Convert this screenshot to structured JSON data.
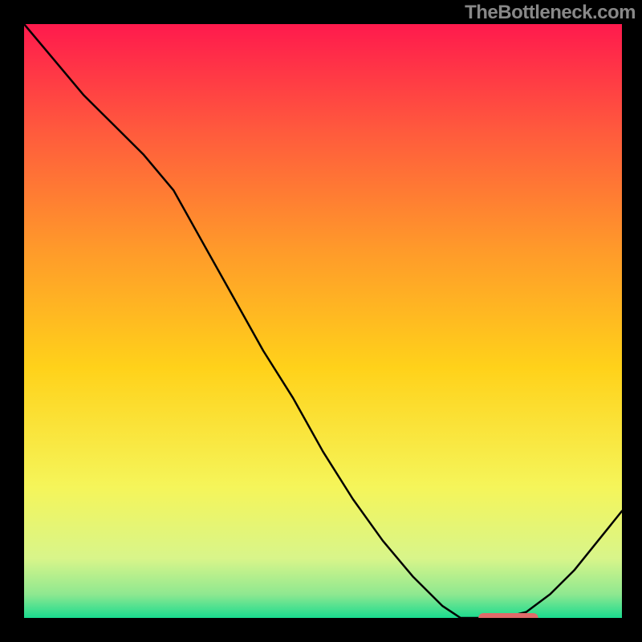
{
  "watermark": "TheBottleneck.com",
  "colors": {
    "gradient_stops": [
      {
        "offset": "0%",
        "color": "#ff1a4d"
      },
      {
        "offset": "18%",
        "color": "#ff5a3d"
      },
      {
        "offset": "38%",
        "color": "#ff9a2a"
      },
      {
        "offset": "58%",
        "color": "#ffd21a"
      },
      {
        "offset": "78%",
        "color": "#f5f55a"
      },
      {
        "offset": "90%",
        "color": "#d8f58a"
      },
      {
        "offset": "96%",
        "color": "#8fe890"
      },
      {
        "offset": "100%",
        "color": "#1adb8f"
      }
    ],
    "marker": "#e06a6a",
    "curve": "#000000",
    "frame": "#000000"
  },
  "chart_data": {
    "type": "line",
    "title": "",
    "xlabel": "",
    "ylabel": "",
    "xlim": [
      0,
      100
    ],
    "ylim": [
      0,
      100
    ],
    "grid": false,
    "legend": false,
    "x": [
      0,
      5,
      10,
      15,
      20,
      25,
      30,
      35,
      40,
      45,
      50,
      55,
      60,
      65,
      70,
      73,
      76,
      80,
      84,
      88,
      92,
      96,
      100
    ],
    "y": [
      100,
      94,
      88,
      83,
      78,
      72,
      63,
      54,
      45,
      37,
      28,
      20,
      13,
      7,
      2,
      0,
      0,
      0,
      1,
      4,
      8,
      13,
      18
    ],
    "optimal_range_x": [
      76,
      86
    ],
    "optimal_y": 0
  }
}
